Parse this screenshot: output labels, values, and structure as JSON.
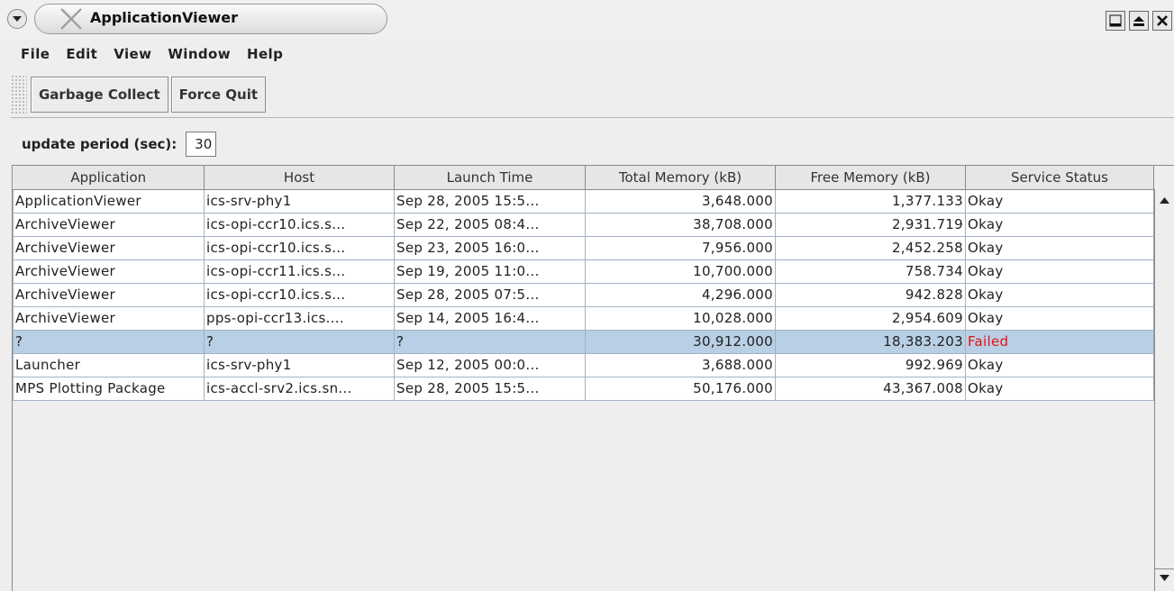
{
  "window": {
    "title": "ApplicationViewer"
  },
  "menu": [
    "File",
    "Edit",
    "View",
    "Window",
    "Help"
  ],
  "toolbar": {
    "garbage_collect_label": "Garbage Collect",
    "force_quit_label": "Force Quit"
  },
  "update": {
    "label": "update period (sec):",
    "value": "30"
  },
  "table": {
    "columns": [
      "Application",
      "Host",
      "Launch Time",
      "Total Memory (kB)",
      "Free Memory (kB)",
      "Service Status"
    ],
    "rows": [
      {
        "application": "ApplicationViewer",
        "host": "ics-srv-phy1",
        "launch_time": "Sep 28, 2005 15:5...",
        "total_memory": "3,648.000",
        "free_memory": "1,377.133",
        "status": "Okay",
        "selected": false
      },
      {
        "application": "ArchiveViewer",
        "host": "ics-opi-ccr10.ics.s...",
        "launch_time": "Sep 22, 2005 08:4...",
        "total_memory": "38,708.000",
        "free_memory": "2,931.719",
        "status": "Okay",
        "selected": false
      },
      {
        "application": "ArchiveViewer",
        "host": "ics-opi-ccr10.ics.s...",
        "launch_time": "Sep 23, 2005 16:0...",
        "total_memory": "7,956.000",
        "free_memory": "2,452.258",
        "status": "Okay",
        "selected": false
      },
      {
        "application": "ArchiveViewer",
        "host": "ics-opi-ccr11.ics.s...",
        "launch_time": "Sep 19, 2005 11:0...",
        "total_memory": "10,700.000",
        "free_memory": "758.734",
        "status": "Okay",
        "selected": false
      },
      {
        "application": "ArchiveViewer",
        "host": "ics-opi-ccr10.ics.s...",
        "launch_time": "Sep 28, 2005 07:5...",
        "total_memory": "4,296.000",
        "free_memory": "942.828",
        "status": "Okay",
        "selected": false
      },
      {
        "application": "ArchiveViewer",
        "host": "pps-opi-ccr13.ics....",
        "launch_time": "Sep 14, 2005 16:4...",
        "total_memory": "10,028.000",
        "free_memory": "2,954.609",
        "status": "Okay",
        "selected": false
      },
      {
        "application": "?",
        "host": "?",
        "launch_time": "?",
        "total_memory": "30,912.000",
        "free_memory": "18,383.203",
        "status": "Failed",
        "selected": true
      },
      {
        "application": "Launcher",
        "host": "ics-srv-phy1",
        "launch_time": "Sep 12, 2005 00:0...",
        "total_memory": "3,688.000",
        "free_memory": "992.969",
        "status": "Okay",
        "selected": false
      },
      {
        "application": "MPS Plotting Package",
        "host": "ics-accl-srv2.ics.sn...",
        "launch_time": "Sep 28, 2005 15:5...",
        "total_memory": "50,176.000",
        "free_memory": "43,367.008",
        "status": "Okay",
        "selected": false
      }
    ]
  },
  "colors": {
    "selected_row": "#b8cfe5",
    "failed_text": "#e81010"
  },
  "icons": {
    "window_menu": "chevron-down-icon",
    "app": "x-logo-icon",
    "minimize": "minimize-icon",
    "maximize": "maximize-icon",
    "close": "close-icon"
  }
}
